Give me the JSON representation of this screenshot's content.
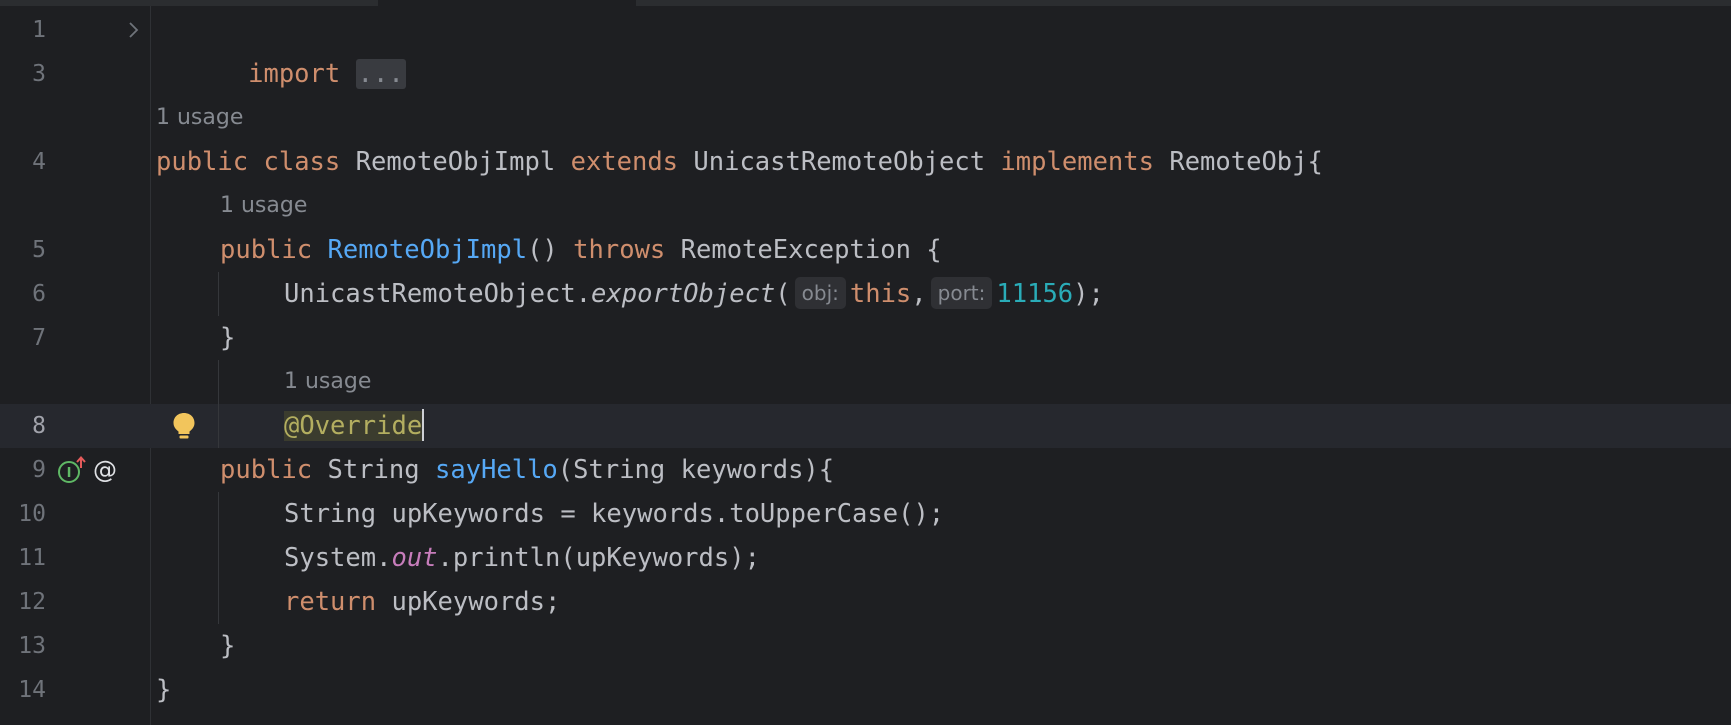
{
  "editor": {
    "lines": {
      "l1": {
        "number": "1",
        "keyword": "import",
        "folded": "..."
      },
      "l3": {
        "number": "3"
      },
      "usage_class": "1 usage",
      "l4": {
        "number": "4",
        "kw1": "public",
        "kw2": "class",
        "name": "RemoteObjImpl",
        "kw3": "extends",
        "parent": "UnicastRemoteObject",
        "kw4": "implements",
        "iface": "RemoteObj{"
      },
      "usage_ctor": "1 usage",
      "l5": {
        "number": "5",
        "kw1": "public",
        "ctor": "RemoteObjImpl",
        "paren": "()",
        "kw2": "throws",
        "exc": "RemoteException {"
      },
      "l6": {
        "number": "6",
        "cls": "UnicastRemoteObject.",
        "method": "exportObject",
        "open": "(",
        "hint1": "obj:",
        "this": "this",
        "comma": ",",
        "hint2": "port:",
        "port": "11156",
        "close": ");"
      },
      "l7": {
        "number": "7",
        "brace": "}"
      },
      "usage_method": "1 usage",
      "l8": {
        "number": "8",
        "annotation": "@Override"
      },
      "l9": {
        "number": "9",
        "kw1": "public",
        "type": "String",
        "method": "sayHello",
        "params": "(String keywords){"
      },
      "l10": {
        "number": "10",
        "code": "String upKeywords = keywords.toUpperCase();"
      },
      "l11": {
        "number": "11",
        "pre": "System.",
        "field": "out",
        "post": ".println(upKeywords);"
      },
      "l12": {
        "number": "12",
        "kw": "return",
        "rest": " upKeywords;"
      },
      "l13": {
        "number": "13",
        "brace": "}"
      },
      "l14": {
        "number": "14",
        "brace": "}"
      }
    },
    "colors": {
      "background": "#1e1f22",
      "keyword": "#cf8e6d",
      "function": "#56a8f5",
      "number": "#2aacb8",
      "annotation": "#b3ae60",
      "static_field": "#c77dbb",
      "text": "#bcbec4"
    },
    "icons": [
      "chevron-right-icon",
      "lightbulb-icon",
      "implements-method-icon",
      "annotation-icon"
    ]
  }
}
